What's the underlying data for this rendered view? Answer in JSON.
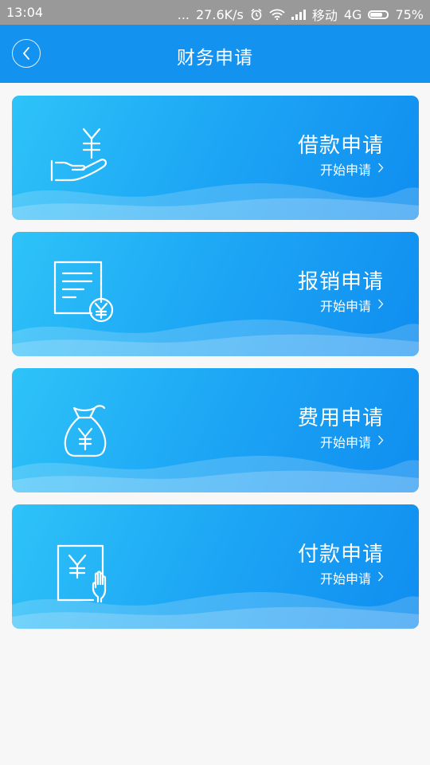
{
  "status_bar": {
    "time": "13:04",
    "dots": "...",
    "net_speed": "27.6K/s",
    "carrier": "移动",
    "network": "4G",
    "battery": "75%",
    "icons": [
      "alarm-icon",
      "wifi-icon",
      "signal-icon",
      "battery-icon"
    ]
  },
  "header": {
    "title": "财务申请",
    "back_icon": "chevron-left-icon"
  },
  "cards": [
    {
      "title": "借款申请",
      "subtitle": "开始申请",
      "icon": "hand-yuan-icon"
    },
    {
      "title": "报销申请",
      "subtitle": "开始申请",
      "icon": "document-yuan-icon"
    },
    {
      "title": "费用申请",
      "subtitle": "开始申请",
      "icon": "money-bag-icon"
    },
    {
      "title": "付款申请",
      "subtitle": "开始申请",
      "icon": "document-hand-icon"
    }
  ],
  "colors": {
    "header": "#1392f0",
    "card_gradient_start": "#2ec3f8",
    "card_gradient_end": "#0f8df0",
    "background": "#f7f7f7",
    "status_bar": "#999999"
  }
}
